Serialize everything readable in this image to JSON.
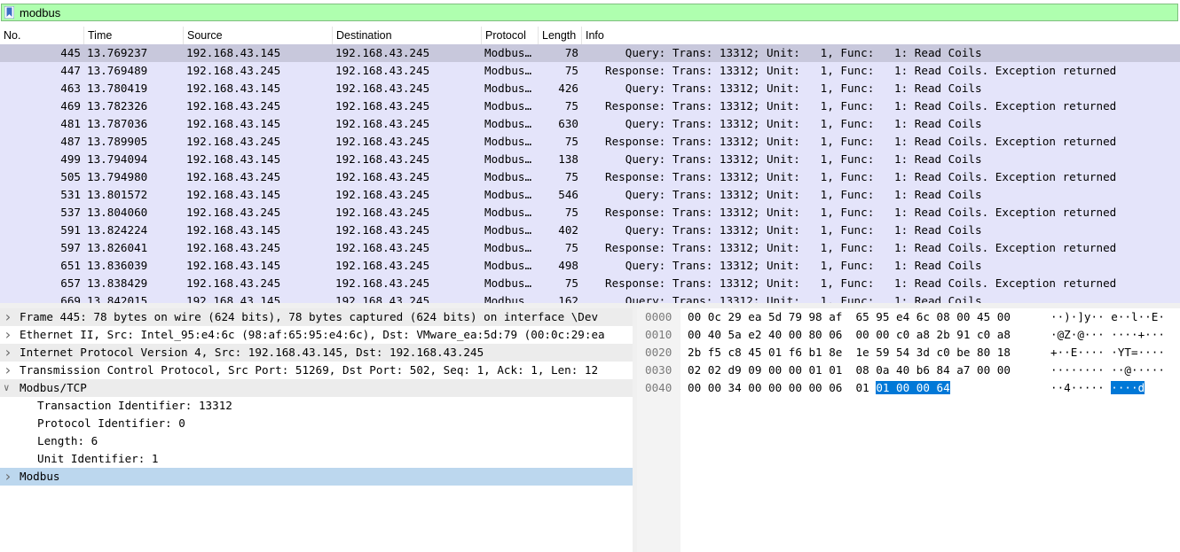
{
  "filter": {
    "value": "modbus"
  },
  "columns": [
    "No.",
    "Time",
    "Source",
    "Destination",
    "Protocol",
    "Length",
    "Info"
  ],
  "packets": [
    {
      "no": "445",
      "time": "13.769237",
      "src": "192.168.43.145",
      "dst": "192.168.43.245",
      "proto": "Modbus…",
      "len": "78",
      "info": "   Query: Trans: 13312; Unit:   1, Func:   1: Read Coils"
    },
    {
      "no": "447",
      "time": "13.769489",
      "src": "192.168.43.245",
      "dst": "192.168.43.245",
      "proto": "Modbus…",
      "len": "75",
      "info": "Response: Trans: 13312; Unit:   1, Func:   1: Read Coils. Exception returned"
    },
    {
      "no": "463",
      "time": "13.780419",
      "src": "192.168.43.145",
      "dst": "192.168.43.245",
      "proto": "Modbus…",
      "len": "426",
      "info": "   Query: Trans: 13312; Unit:   1, Func:   1: Read Coils"
    },
    {
      "no": "469",
      "time": "13.782326",
      "src": "192.168.43.245",
      "dst": "192.168.43.245",
      "proto": "Modbus…",
      "len": "75",
      "info": "Response: Trans: 13312; Unit:   1, Func:   1: Read Coils. Exception returned"
    },
    {
      "no": "481",
      "time": "13.787036",
      "src": "192.168.43.145",
      "dst": "192.168.43.245",
      "proto": "Modbus…",
      "len": "630",
      "info": "   Query: Trans: 13312; Unit:   1, Func:   1: Read Coils"
    },
    {
      "no": "487",
      "time": "13.789905",
      "src": "192.168.43.245",
      "dst": "192.168.43.245",
      "proto": "Modbus…",
      "len": "75",
      "info": "Response: Trans: 13312; Unit:   1, Func:   1: Read Coils. Exception returned"
    },
    {
      "no": "499",
      "time": "13.794094",
      "src": "192.168.43.145",
      "dst": "192.168.43.245",
      "proto": "Modbus…",
      "len": "138",
      "info": "   Query: Trans: 13312; Unit:   1, Func:   1: Read Coils"
    },
    {
      "no": "505",
      "time": "13.794980",
      "src": "192.168.43.245",
      "dst": "192.168.43.245",
      "proto": "Modbus…",
      "len": "75",
      "info": "Response: Trans: 13312; Unit:   1, Func:   1: Read Coils. Exception returned"
    },
    {
      "no": "531",
      "time": "13.801572",
      "src": "192.168.43.145",
      "dst": "192.168.43.245",
      "proto": "Modbus…",
      "len": "546",
      "info": "   Query: Trans: 13312; Unit:   1, Func:   1: Read Coils"
    },
    {
      "no": "537",
      "time": "13.804060",
      "src": "192.168.43.245",
      "dst": "192.168.43.245",
      "proto": "Modbus…",
      "len": "75",
      "info": "Response: Trans: 13312; Unit:   1, Func:   1: Read Coils. Exception returned"
    },
    {
      "no": "591",
      "time": "13.824224",
      "src": "192.168.43.145",
      "dst": "192.168.43.245",
      "proto": "Modbus…",
      "len": "402",
      "info": "   Query: Trans: 13312; Unit:   1, Func:   1: Read Coils"
    },
    {
      "no": "597",
      "time": "13.826041",
      "src": "192.168.43.245",
      "dst": "192.168.43.245",
      "proto": "Modbus…",
      "len": "75",
      "info": "Response: Trans: 13312; Unit:   1, Func:   1: Read Coils. Exception returned"
    },
    {
      "no": "651",
      "time": "13.836039",
      "src": "192.168.43.145",
      "dst": "192.168.43.245",
      "proto": "Modbus…",
      "len": "498",
      "info": "   Query: Trans: 13312; Unit:   1, Func:   1: Read Coils"
    },
    {
      "no": "657",
      "time": "13.838429",
      "src": "192.168.43.245",
      "dst": "192.168.43.245",
      "proto": "Modbus…",
      "len": "75",
      "info": "Response: Trans: 13312; Unit:   1, Func:   1: Read Coils. Exception returned"
    },
    {
      "no": "669",
      "time": "13.842015",
      "src": "192.168.43.145",
      "dst": "192.168.43.245",
      "proto": "Modbus…",
      "len": "162",
      "info": "   Query: Trans: 13312; Unit:   1, Func:   1: Read Coils"
    }
  ],
  "selected_index": 0,
  "details": [
    {
      "arrow": ">",
      "indent": 0,
      "shade": true,
      "hl": false,
      "text": "Frame 445: 78 bytes on wire (624 bits), 78 bytes captured (624 bits) on interface \\Dev"
    },
    {
      "arrow": ">",
      "indent": 0,
      "shade": false,
      "hl": false,
      "text": "Ethernet II, Src: Intel_95:e4:6c (98:af:65:95:e4:6c), Dst: VMware_ea:5d:79 (00:0c:29:ea"
    },
    {
      "arrow": ">",
      "indent": 0,
      "shade": true,
      "hl": false,
      "text": "Internet Protocol Version 4, Src: 192.168.43.145, Dst: 192.168.43.245"
    },
    {
      "arrow": ">",
      "indent": 0,
      "shade": false,
      "hl": false,
      "text": "Transmission Control Protocol, Src Port: 51269, Dst Port: 502, Seq: 1, Ack: 1, Len: 12"
    },
    {
      "arrow": "v",
      "indent": 0,
      "shade": true,
      "hl": false,
      "text": "Modbus/TCP"
    },
    {
      "arrow": "",
      "indent": 1,
      "shade": false,
      "hl": false,
      "text": "Transaction Identifier: 13312"
    },
    {
      "arrow": "",
      "indent": 1,
      "shade": false,
      "hl": false,
      "text": "Protocol Identifier: 0"
    },
    {
      "arrow": "",
      "indent": 1,
      "shade": false,
      "hl": false,
      "text": "Length: 6"
    },
    {
      "arrow": "",
      "indent": 1,
      "shade": false,
      "hl": false,
      "text": "Unit Identifier: 1"
    },
    {
      "arrow": ">",
      "indent": 0,
      "shade": false,
      "hl": true,
      "text": "Modbus"
    }
  ],
  "bytes": [
    {
      "off": "0000",
      "hex": "00 0c 29 ea 5d 79 98 af  65 95 e4 6c 08 00 45 00",
      "hex_hl": "",
      "asc": "··)·]y·· e··l··E·",
      "asc_hl": ""
    },
    {
      "off": "0010",
      "hex": "00 40 5a e2 40 00 80 06  00 00 c0 a8 2b 91 c0 a8",
      "hex_hl": "",
      "asc": "·@Z·@··· ····+···",
      "asc_hl": ""
    },
    {
      "off": "0020",
      "hex": "2b f5 c8 45 01 f6 b1 8e  1e 59 54 3d c0 be 80 18",
      "hex_hl": "",
      "asc": "+··E···· ·YT=····",
      "asc_hl": ""
    },
    {
      "off": "0030",
      "hex": "02 02 d9 09 00 00 01 01  08 0a 40 b6 84 a7 00 00",
      "hex_hl": "",
      "asc": "········ ··@·····",
      "asc_hl": ""
    },
    {
      "off": "0040",
      "hex": "00 00 34 00 00 00 00 06  01 ",
      "hex_hl": "01 00 00 64",
      "asc": "··4····· ",
      "asc_hl": "····d"
    }
  ]
}
